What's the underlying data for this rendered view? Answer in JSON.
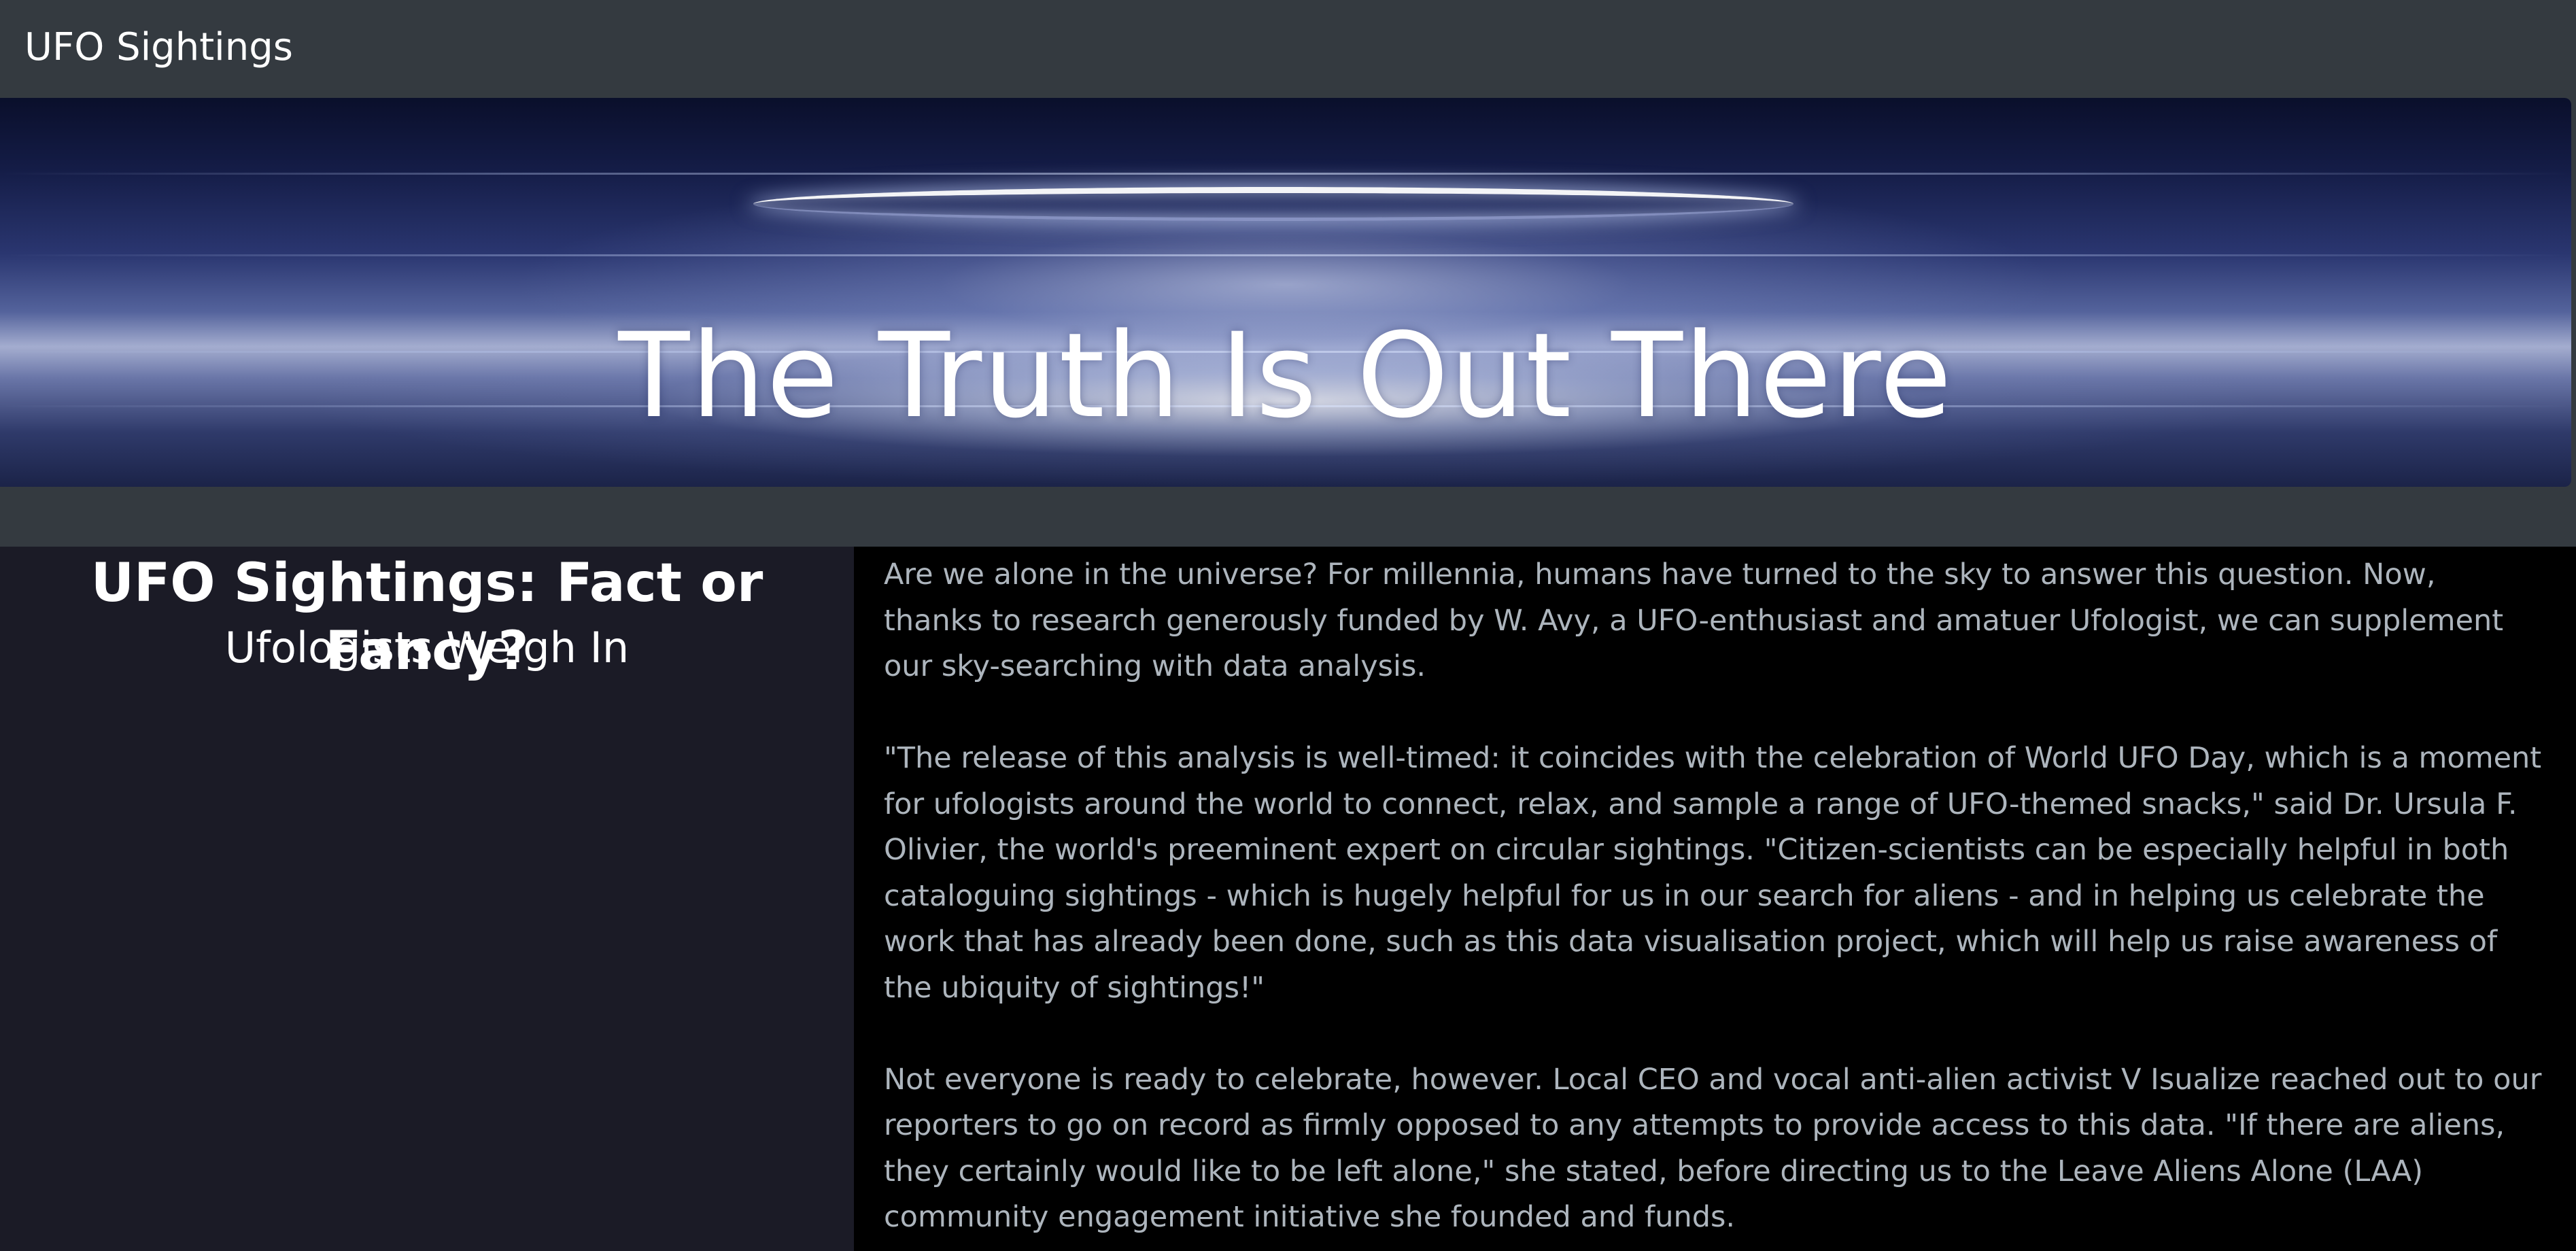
{
  "navbar": {
    "brand": "UFO Sightings"
  },
  "hero": {
    "title": "The Truth Is Out There"
  },
  "sidebar": {
    "title": "UFO Sightings: Fact or Fancy?",
    "subtitle": "Ufologists Weigh In"
  },
  "article": {
    "paragraphs": [
      "Are we alone in the universe? For millennia, humans have turned to the sky to answer this question. Now, thanks to research generously funded by W. Avy, a UFO-enthusiast and amatuer Ufologist, we can supplement our sky-searching with data analysis.",
      "\"The release of this analysis is well-timed: it coincides with the celebration of World UFO Day, which is a moment for ufologists around the world to connect, relax, and sample a range of UFO-themed snacks,\" said Dr. Ursula F. Olivier, the world's preeminent expert on circular sightings. \"Citizen-scientists can be especially helpful in both cataloguing sightings - which is hugely helpful for us in our search for aliens - and in helping us celebrate the work that has already been done, such as this data visualisation project, which will help us raise awareness of the ubiquity of sightings!\"",
      "Not everyone is ready to celebrate, however. Local CEO and vocal anti-alien activist V Isualize reached out to our reporters to go on record as firmly opposed to any attempts to provide access to this data. \"If there are aliens, they certainly would like to be left alone,\" she stated, before directing us to the Leave Aliens Alone (LAA) community engagement initiative she founded and funds."
    ]
  }
}
